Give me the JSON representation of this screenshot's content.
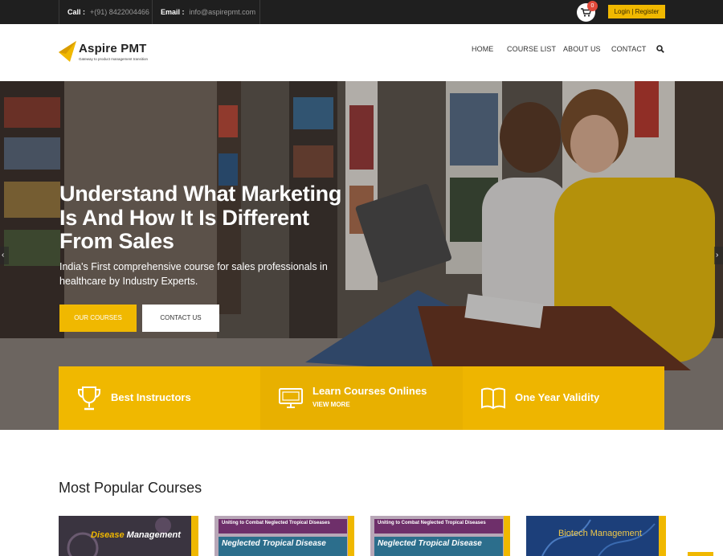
{
  "topbar": {
    "call_label": "Call :",
    "call_value": "+(91) 8422004466",
    "email_label": "Email :",
    "email_value": "info@aspirepmt.com",
    "cart_count": "0",
    "login_label": "Login | Register"
  },
  "header": {
    "logo_name": "Aspire PMT",
    "logo_tagline": "Gateway to product management transition",
    "nav": [
      "HOME",
      "COURSE LIST",
      "ABOUT US",
      "CONTACT"
    ]
  },
  "hero": {
    "title": "Understand What Marketing Is And How It Is Different From Sales",
    "subtitle": "India's First comprehensive course for sales professionals in healthcare by Industry Experts.",
    "primary_button": "OUR COURSES",
    "secondary_button": "CONTACT US"
  },
  "features": [
    {
      "label": "Best Instructors",
      "icon": "trophy-icon"
    },
    {
      "label": "Learn Courses Onlines",
      "sub": "VIEW MORE",
      "icon": "monitor-icon"
    },
    {
      "label": "One Year Validity",
      "icon": "book-icon"
    }
  ],
  "courses": {
    "section_title": "Most Popular Courses",
    "cards": [
      {
        "label_a": "Disease",
        "label_b": "Management"
      },
      {
        "strip": "Uniting to Combat Neglected Tropical Diseases",
        "title": "Neglected Tropical Disease"
      },
      {
        "strip": "Uniting to Combat Neglected Tropical Diseases",
        "title": "Neglected Tropical Disease"
      },
      {
        "label": "Biotech Management"
      }
    ]
  },
  "colors": {
    "accent": "#f0b800",
    "topbar_bg": "#1f1f1f",
    "badge": "#e0493a"
  }
}
